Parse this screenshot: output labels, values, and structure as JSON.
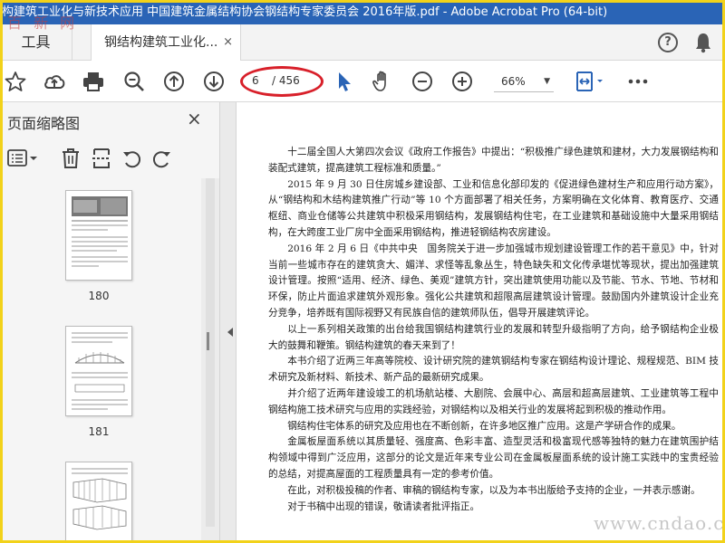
{
  "window": {
    "title": "构建筑工业化与新技术应用 中国建筑金属结构协会钢结构专家委员会 2016年版.pdf - Adobe Acrobat Pro (64-bit)"
  },
  "watermark": {
    "logo": "百 新 网",
    "url": "www.cndao.com"
  },
  "tabs": {
    "tools_label": "工具",
    "doc_label": "钢结构建筑工业化...",
    "close_glyph": "×"
  },
  "header_icons": {
    "help": "?",
    "help_icon": "help-circle-icon",
    "bell_icon": "bell-icon"
  },
  "toolbar": {
    "current_page": "6",
    "total_pages": "/ 456",
    "zoom": "66%",
    "zoom_caret": "▼",
    "icons": [
      "star-icon",
      "cloud-upload-icon",
      "print-icon",
      "zoom-search-icon",
      "page-up-icon",
      "page-down-icon",
      "select-arrow-icon",
      "hand-icon",
      "zoom-out-icon",
      "zoom-in-icon",
      "fit-width-icon",
      "more-icon"
    ]
  },
  "thumbnail_panel": {
    "title": "页面缩略图",
    "close_glyph": "×",
    "pages": [
      {
        "label": "180"
      },
      {
        "label": "181"
      },
      {
        "label": ""
      }
    ]
  },
  "document": {
    "paragraphs": [
      "十二届全国人大第四次会议《政府工作报告》中提出：“积极推广绿色建筑和建材，大力发展钢结构和装配式建筑，提高建筑工程标准和质量。”",
      "2015 年 9 月 30 日住房城乡建设部、工业和信息化部印发的《促进绿色建材生产和应用行动方案》，从“钢结构和木结构建筑推广行动”等 10 个方面部署了相关任务，方案明确在文化体育、教育医疗、交通枢纽、商业仓储等公共建筑中积极采用钢结构，发展钢结构住宅，在工业建筑和基础设施中大量采用钢结构，在大跨度工业厂房中全面采用钢结构，推进轻钢结构农房建设。",
      "2016 年 2 月 6 日《中共中央　国务院关于进一步加强城市规划建设管理工作的若干意见》中，针对当前一些城市存在的建筑贪大、媚洋、求怪等乱象丛生，特色缺失和文化传承堪忧等现状，提出加强建筑设计管理。按照“适用、经济、绿色、美观”建筑方针，突出建筑使用功能以及节能、节水、节地、节材和环保，防止片面追求建筑外观形象。强化公共建筑和超限高层建筑设计管理。鼓励国内外建筑设计企业充分竞争，培养既有国际视野又有民族自信的建筑师队伍，倡导开展建筑评论。",
      "以上一系列相关政策的出台给我国钢结构建筑行业的发展和转型升级指明了方向，给予钢结构企业极大的鼓舞和鞭策。钢结构建筑的春天来到了！",
      "本书介绍了近两三年高等院校、设计研究院的建筑钢结构专家在钢结构设计理论、规程规范、BIM 技术研究及新材料、新技术、新产品的最新研究成果。",
      "并介绍了近两年建设竣工的机场航站楼、大剧院、会展中心、高层和超高层建筑、工业建筑等工程中钢结构施工技术研究与应用的实践经验，对钢结构以及相关行业的发展将起到积极的推动作用。",
      "钢结构住宅体系的研究及应用也在不断创新，在许多地区推广应用。这是产学研合作的成果。",
      "金属板屋面系统以其质量轻、强度高、色彩丰富、造型灵活和极富现代感等独特的魅力在建筑围护结构领域中得到广泛应用，这部分的论文是近年来专业公司在金属板屋面系统的设计施工实践中的宝贵经验的总结，对提高屋面的工程质量具有一定的参考价值。",
      "在此，对积极投稿的作者、审稿的钢结构专家，以及为本书出版给予支持的企业，一并表示感谢。",
      "对于书稿中出现的错误，敬请读者批评指正。"
    ]
  },
  "colors": {
    "titlebar": "#2a64b6",
    "frame": "#f2d21a",
    "annotation_ellipse": "#d8202a",
    "select_tool": "#2a64b6"
  }
}
